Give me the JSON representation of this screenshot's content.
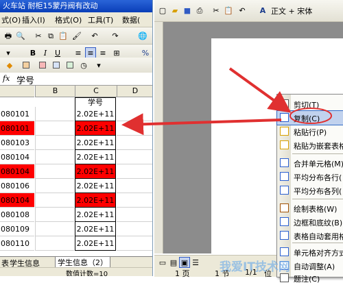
{
  "excel": {
    "title": "火车站  耐柜15蒙丹阀有改动",
    "menu": {
      "format_partial": "式(O)",
      "insert": "插入(I)",
      "format": "格式(O)",
      "tools": "工具(T)",
      "data": "数据("
    },
    "toolbar": {
      "bold": "B",
      "italic": "I",
      "underline": "U",
      "percent": "%"
    },
    "formula": {
      "fx": "fx",
      "value": "学号"
    },
    "col_headers": [
      "B",
      "C",
      "D"
    ],
    "col_c_header": "学号",
    "rows": [
      {
        "a": "080101",
        "c": "2.02E+11",
        "highlight": false
      },
      {
        "a": "080101",
        "c": "2.02E+11",
        "highlight": true
      },
      {
        "a": "080103",
        "c": "2.02E+11",
        "highlight": false
      },
      {
        "a": "080104",
        "c": "2.02E+11",
        "highlight": false
      },
      {
        "a": "080104",
        "c": "2.02E+11",
        "highlight": true
      },
      {
        "a": "080106",
        "c": "2.02E+11",
        "highlight": false
      },
      {
        "a": "080104",
        "c": "2.02E+11",
        "highlight": true
      },
      {
        "a": "080108",
        "c": "2.02E+11",
        "highlight": false
      },
      {
        "a": "080109",
        "c": "2.02E+11",
        "highlight": false
      },
      {
        "a": "080110",
        "c": "2.02E+11",
        "highlight": false
      }
    ],
    "sheet_tabs": {
      "tab1": "表",
      "tab2": "学生信息",
      "tab3": "学生信息（2）"
    },
    "status": "数值计数=10"
  },
  "word": {
    "toolbar": {
      "style": "正文 + 宋体",
      "font_indicator": "A"
    },
    "context_menu": [
      {
        "label": "剪切(T)",
        "icon": "scissors-icon"
      },
      {
        "label": "复制(C)",
        "icon": "copy-icon"
      },
      {
        "label": "粘贴行(P)",
        "icon": "paste-icon"
      },
      {
        "label": "粘贴为嵌套表格",
        "icon": "paste-nested-icon"
      },
      {
        "label": "合并单元格(M)",
        "icon": "merge-cells-icon"
      },
      {
        "label": "平均分布各行(",
        "icon": "distribute-rows-icon"
      },
      {
        "label": "平均分布各列(",
        "icon": "distribute-cols-icon"
      },
      {
        "label": "绘制表格(W)",
        "icon": "draw-table-icon"
      },
      {
        "label": "边框和底纹(B)",
        "icon": "borders-icon"
      },
      {
        "label": "表格自动套用格",
        "icon": "autoformat-icon"
      },
      {
        "label": "单元格对齐方式",
        "icon": "cell-align-icon"
      },
      {
        "label": "自动调整(A)",
        "icon": "autofit-icon"
      },
      {
        "label": "题注(C)",
        "icon": "caption-icon"
      }
    ],
    "status": {
      "page": "1 页",
      "section": "1 节",
      "pages": "1/1",
      "pos": "位"
    }
  },
  "watermark": {
    "text": "我爱IT技术网"
  },
  "colors": {
    "highlight": "#ff0000",
    "arrow": "#e03030",
    "titlebar": "#0a3fb8"
  }
}
